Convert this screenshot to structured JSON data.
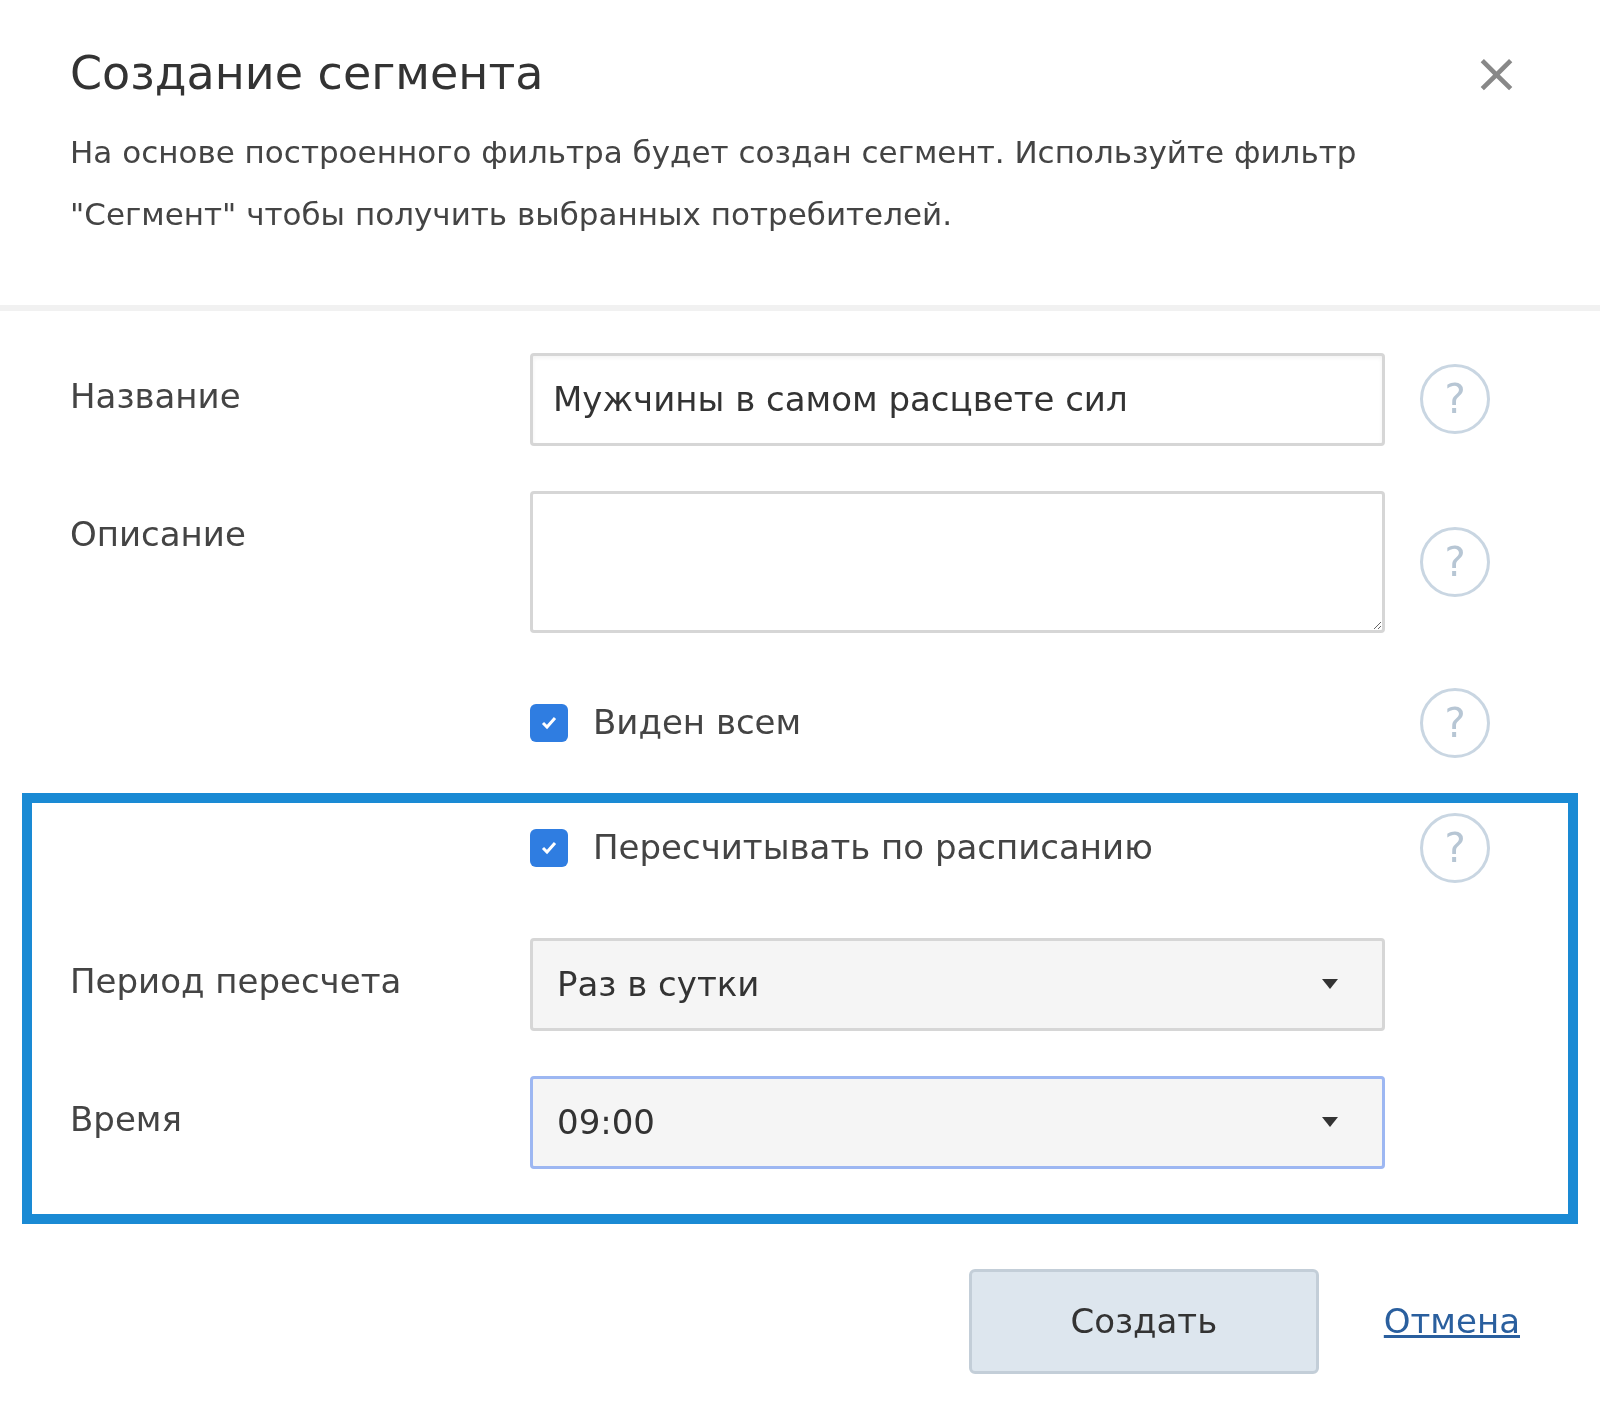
{
  "dialog": {
    "title": "Создание сегмента",
    "close": "×",
    "description": "На основе построенного фильтра будет создан сегмент. Используйте фильтр \"Сегмент\" чтобы получить выбранных потребителей."
  },
  "fields": [
    {
      "kind": "text",
      "label": "Название",
      "value": "Мужчины в самом расцвете сил",
      "help": "?"
    },
    {
      "kind": "textarea",
      "label": "Описание",
      "help": "?"
    },
    {
      "kind": "checkbox",
      "label": "Виден всем",
      "checked": true,
      "help": "?"
    }
  ],
  "schedule": {
    "highlighted": true,
    "fields": [
      {
        "kind": "checkbox",
        "label": "Пересчитывать по расписанию",
        "checked": true,
        "help": "?"
      },
      {
        "kind": "select",
        "label": "Период пересчета",
        "value": "Раз в сутки",
        "focused": false
      },
      {
        "kind": "select",
        "label": "Время",
        "value": "09:00",
        "focused": true
      }
    ]
  },
  "buttons": {
    "primary": "Создать",
    "cancel": "Отмена"
  }
}
